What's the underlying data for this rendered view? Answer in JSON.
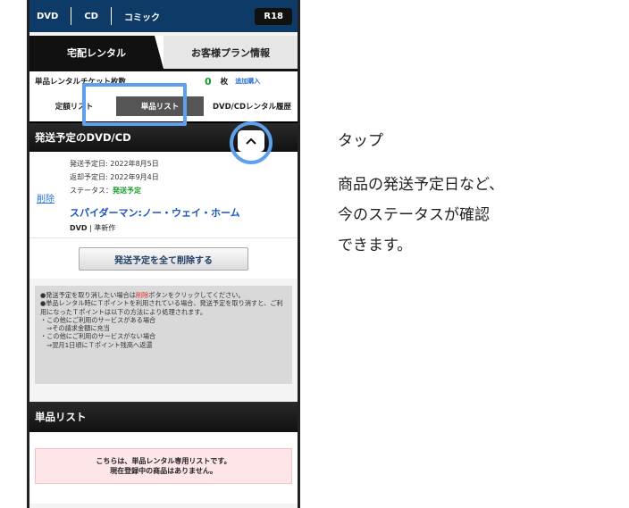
{
  "topnav": {
    "items": [
      "DVD",
      "CD",
      "コミック"
    ],
    "r18": "R18"
  },
  "tabs": {
    "active": "宅配レンタル",
    "inactive": "お客様プラン情報"
  },
  "ticket": {
    "label": "単品レンタルチケット枚数",
    "count": "0",
    "unit": "枚",
    "buy_link": "追加購入"
  },
  "subtabs": {
    "teigaku": "定額リスト",
    "tanpin": "単品リスト",
    "rireki": "DVD/CDレンタル履歴"
  },
  "section1": {
    "title": "発送予定のDVD/CD"
  },
  "item": {
    "delete_link": "削除",
    "ship_date": "発送予定日: 2022年8月5日",
    "return_date": "返却予定日: 2022年9月4日",
    "status_label": "ステータス：",
    "status_value": "発送予定",
    "title": "スパイダーマン:ノー・ウェイ・ホーム",
    "format": "DVD",
    "release_note": "準新作"
  },
  "delete_all_button": "発送予定を全て削除する",
  "notes": {
    "line1_pre": "●発送予定を取り消したい場合は",
    "line1_red": "削除",
    "line1_post": "ボタンをクリックしてください。",
    "line2": "●単品レンタル時にＴポイントを利用されている場合、発送予定を取り消すと、ご利用になったＴポイントは以下の方法により処理されます。",
    "line3": "・この他にご利用のサービスがある場合",
    "line4": "　⇒その請求金額に充当",
    "line5": "・この他にご利用のサービスがない場合",
    "line6": "　⇒翌月1日頃にＴポイント残高へ返還"
  },
  "section2": {
    "title": "単品リスト"
  },
  "empty_message": {
    "line1": "こちらは、単品レンタル専用リストです。",
    "line2": "現在登録中の商品はありません。"
  },
  "annotation": {
    "tap": "タップ",
    "desc_line1": "商品の発送予定日など、",
    "desc_line2": "今のステータスが確認",
    "desc_line3": "できます。"
  },
  "colors": {
    "nav_bg": "#0e3a67",
    "highlight": "#5da0ee",
    "status_green": "#1a9a2a",
    "link_blue": "#2a6fd0"
  }
}
